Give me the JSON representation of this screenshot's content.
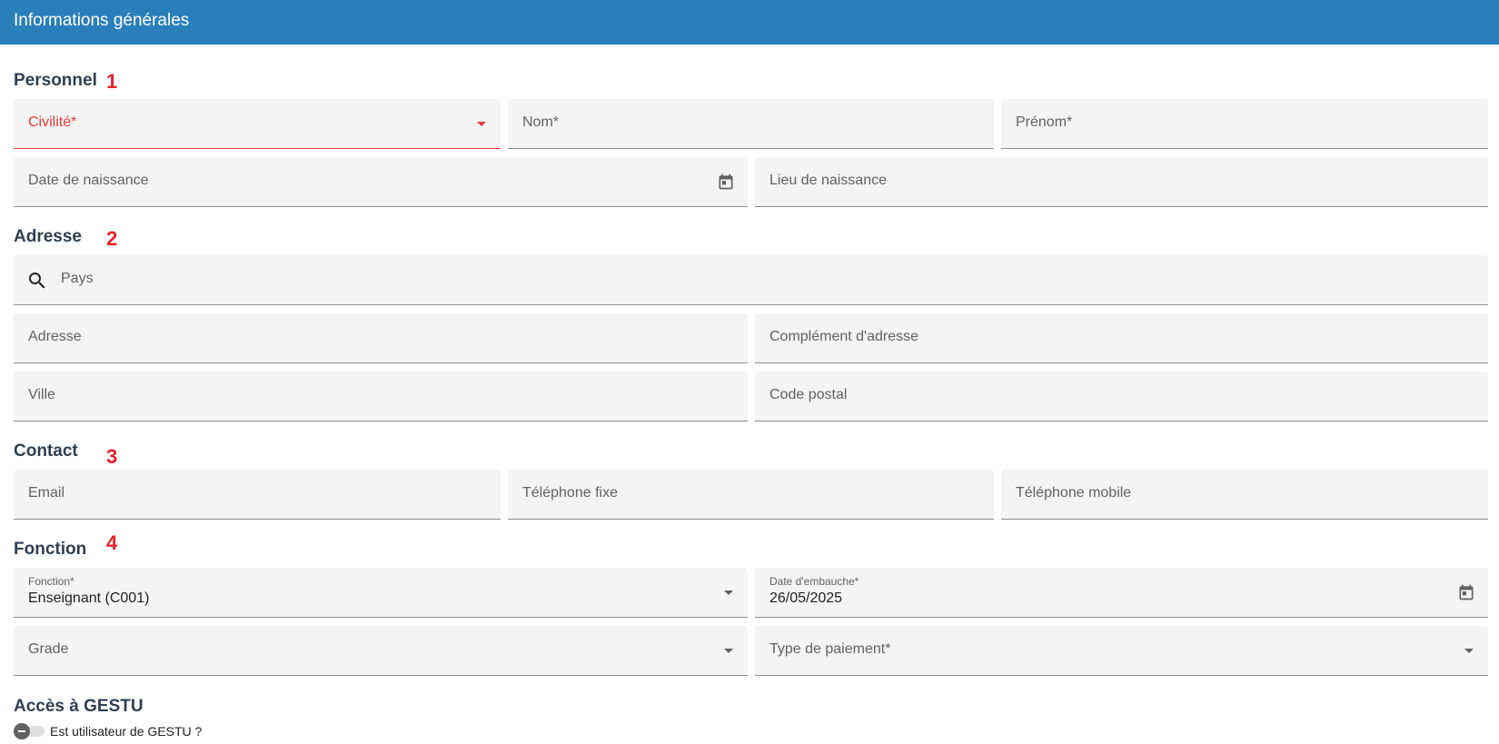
{
  "header": {
    "title": "Informations générales"
  },
  "sections": {
    "personnel": {
      "title": "Personnel",
      "marker": "1"
    },
    "adresse": {
      "title": "Adresse",
      "marker": "2"
    },
    "contact": {
      "title": "Contact",
      "marker": "3"
    },
    "fonction": {
      "title": "Fonction",
      "marker": "4"
    },
    "acces": {
      "title": "Accès à GESTU"
    }
  },
  "personnel": {
    "civilite": {
      "placeholder": "Civilité*"
    },
    "nom": {
      "placeholder": "Nom*"
    },
    "prenom": {
      "placeholder": "Prénom*"
    },
    "date_naissance": {
      "placeholder": "Date de naissance"
    },
    "lieu_naissance": {
      "placeholder": "Lieu de naissance"
    }
  },
  "adresse": {
    "pays": {
      "placeholder": "Pays"
    },
    "adresse": {
      "placeholder": "Adresse"
    },
    "complement": {
      "placeholder": "Complément d'adresse"
    },
    "ville": {
      "placeholder": "Ville"
    },
    "code_postal": {
      "placeholder": "Code postal"
    }
  },
  "contact": {
    "email": {
      "placeholder": "Email"
    },
    "tel_fixe": {
      "placeholder": "Téléphone fixe"
    },
    "tel_mobile": {
      "placeholder": "Téléphone mobile"
    }
  },
  "fonction": {
    "fonction": {
      "label": "Fonction*",
      "value": "Enseignant (C001)"
    },
    "date_embauche": {
      "label": "Date d'embauche*",
      "value": "26/05/2025"
    },
    "grade": {
      "placeholder": "Grade"
    },
    "type_paiement": {
      "placeholder": "Type de paiement*"
    }
  },
  "acces": {
    "toggle_label": "Est utilisateur de GESTU ?",
    "toggle_on": false
  },
  "colors": {
    "header": "#2a7fba",
    "section_title": "#2f3f52",
    "marker": "#e8202a",
    "error": "#e53935",
    "field_bg": "#f4f4f4"
  }
}
